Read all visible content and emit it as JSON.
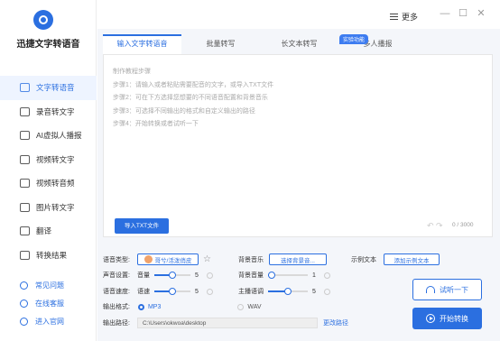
{
  "app": {
    "name": "迅捷文字转语音",
    "accent": "#2b6fe0"
  },
  "topbar": {
    "more_label": "更多",
    "minimize": "—",
    "maximize": "☐",
    "close": "✕"
  },
  "sidebar": {
    "items": [
      {
        "label": "文字转语音",
        "icon": "text-to-speech-icon",
        "active": true
      },
      {
        "label": "录音转文字",
        "icon": "recording-icon"
      },
      {
        "label": "AI虚拟人播报",
        "icon": "ai-avatar-icon"
      },
      {
        "label": "视频转文字",
        "icon": "video-icon"
      },
      {
        "label": "视频转音频",
        "icon": "video-audio-icon"
      },
      {
        "label": "图片转文字",
        "icon": "image-icon"
      },
      {
        "label": "翻译",
        "icon": "translate-icon"
      },
      {
        "label": "转换结果",
        "icon": "result-icon"
      }
    ],
    "links": [
      {
        "label": "常见问题",
        "icon": "question-icon"
      },
      {
        "label": "在线客服",
        "icon": "headset-icon"
      },
      {
        "label": "进入官网",
        "icon": "website-icon"
      }
    ]
  },
  "tabs": [
    {
      "label": "输入文字转语音",
      "active": true
    },
    {
      "label": "批量转写"
    },
    {
      "label": "长文本转写"
    },
    {
      "label": "多人播报"
    }
  ],
  "tab_badge": "实验功能",
  "editor": {
    "steps": [
      "制作教程步骤",
      "步骤1：请输入或者粘贴需要配音的文字，或导入TXT文件",
      "步骤2：可在下方选择您想要的不同语音配置和背景音乐",
      "步骤3：可选择不同输出的格式和自定义输出的路径",
      "步骤4：开始转换或者试听一下"
    ],
    "import_label": "导入TXT文件",
    "counter": "0 / 3000"
  },
  "settings": {
    "voice_type_label": "语音类型:",
    "voice_name": "哥兮/活泼俏皮",
    "bg_music_label": "背景音乐",
    "bg_music_button": "选择背景音...",
    "sample_label": "示例文本",
    "sample_button": "添加示例文本",
    "sound_label": "声音设置:",
    "volume_label": "音量",
    "volume_value": "5",
    "volume_level": 0.5,
    "bg_volume_label": "背景音量",
    "bg_volume_value": "1",
    "bg_volume_level": 0.1,
    "speed_label": "语音速度:",
    "speed_name": "语速",
    "speed_value": "5",
    "speed_level": 0.5,
    "intonation_label": "主播语调",
    "intonation_value": "5",
    "intonation_level": 0.5,
    "format_label": "输出格式:",
    "format_mp3": "MP3",
    "format_wav": "WAV",
    "path_label": "输出路径:",
    "path_value": "C:\\Users\\okwoa\\desktop",
    "change_path": "更改路径"
  },
  "actions": {
    "try_label": "试听一下",
    "start_label": "开始转换"
  }
}
